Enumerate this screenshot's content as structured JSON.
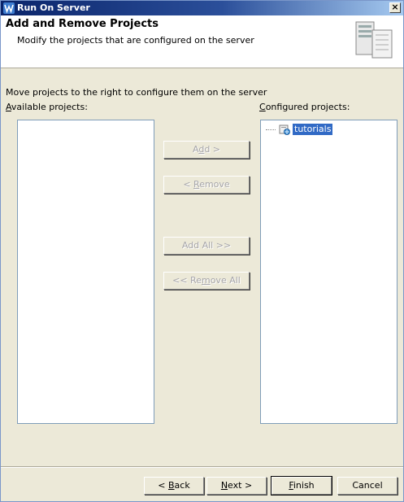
{
  "window": {
    "title": "Run On Server",
    "close_glyph": "×"
  },
  "banner": {
    "title": "Add and Remove Projects",
    "subtitle": "Modify the projects that are configured on the server",
    "art_icon": "server-wizard-icon"
  },
  "main": {
    "instruction": "Move projects to the right to configure them on the server",
    "available_label_mnemonic": "A",
    "available_label_rest": "vailable projects:",
    "configured_label_mnemonic": "C",
    "configured_label_rest": "onfigured projects:",
    "available_projects": [],
    "configured_projects": [
      {
        "name": "tutorials",
        "icon": "web-project-icon",
        "selected": true
      }
    ]
  },
  "buttons": {
    "add": {
      "pre": "A",
      "mn": "d",
      "post": "d >",
      "enabled": false
    },
    "remove": {
      "pre": "< ",
      "mn": "R",
      "post": "emove",
      "enabled": false
    },
    "add_all": {
      "label": "Add All >>",
      "enabled": false
    },
    "remove_all": {
      "pre": "<< Re",
      "mn": "m",
      "post": "ove All",
      "enabled": false
    }
  },
  "footer": {
    "back": {
      "pre": "< ",
      "mn": "B",
      "post": "ack"
    },
    "next": {
      "pre": "",
      "mn": "N",
      "post": "ext >"
    },
    "finish": {
      "pre": "",
      "mn": "F",
      "post": "inish"
    },
    "cancel": {
      "label": "Cancel"
    }
  },
  "colors": {
    "selection": "#316ac5",
    "titlebar": "#0a246a",
    "dialog_bg": "#ece9d8"
  }
}
